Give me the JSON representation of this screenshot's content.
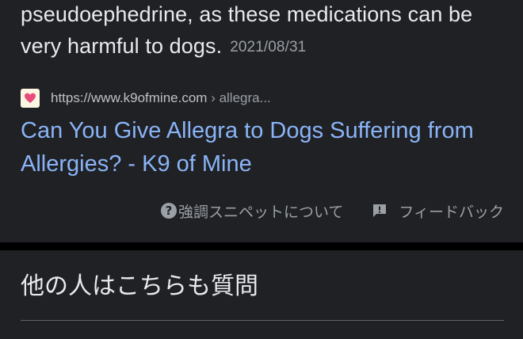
{
  "snippet": {
    "text": "pseudoephedrine, as these medications can be very harmful to dogs.",
    "date": "2021/08/31"
  },
  "result": {
    "favicon_icon": "heart-favicon-icon",
    "url_domain": "https://www.k9ofmine.com",
    "url_path": " › allegra...",
    "title": "Can You Give Allegra to Dogs Suffering from Allergies? - K9 of Mine"
  },
  "footer": {
    "about_label": "強調スニペットについて",
    "feedback_label": "フィードバック"
  },
  "people_also_ask": {
    "heading": "他の人はこちらも質問"
  },
  "colors": {
    "background": "#202124",
    "link": "#8ab4f8",
    "text": "#e8eaed",
    "secondary_text": "#9aa0a6"
  }
}
